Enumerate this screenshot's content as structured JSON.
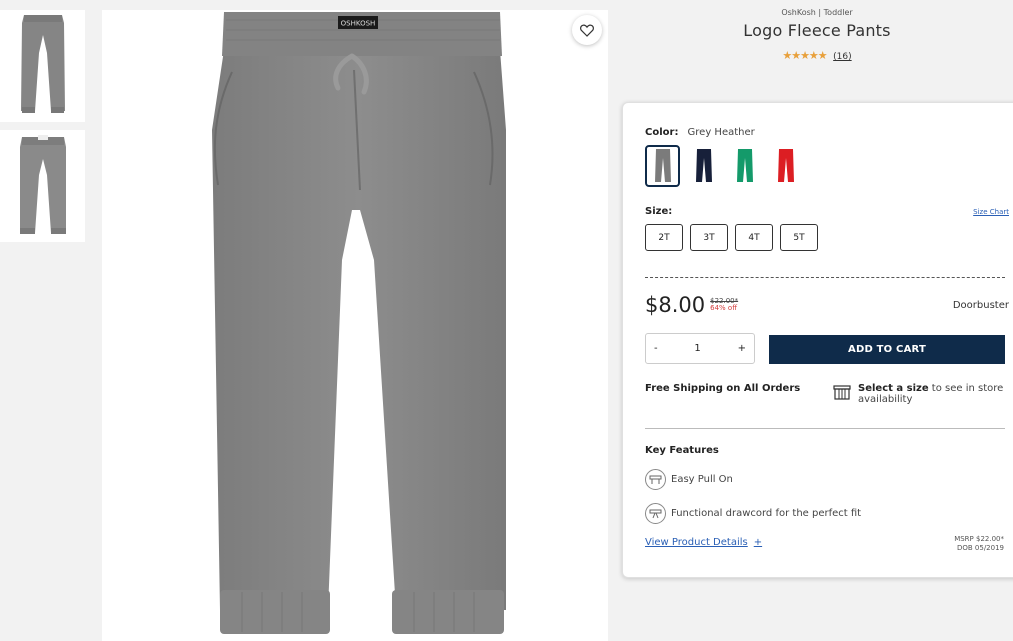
{
  "product": {
    "brand_line": "OshKosh | Toddler",
    "title": "Logo Fleece Pants",
    "stars": "★★★★★",
    "review_count": "(16)"
  },
  "thumbnails": [
    {
      "label": "front view"
    },
    {
      "label": "back view"
    }
  ],
  "main_image": {
    "waistband_logo": "OSHKOSH"
  },
  "color": {
    "label": "Color:",
    "value": "Grey Heather",
    "swatches": [
      {
        "name": "grey",
        "hex": "#7b7b7b",
        "selected": true
      },
      {
        "name": "navy",
        "hex": "#17203a",
        "selected": false
      },
      {
        "name": "green",
        "hex": "#149a6a",
        "selected": false
      },
      {
        "name": "red",
        "hex": "#dc1e23",
        "selected": false
      }
    ]
  },
  "size": {
    "label": "Size:",
    "chart_link": "Size Chart",
    "options": [
      "2T",
      "3T",
      "4T",
      "5T"
    ]
  },
  "price": {
    "current": "$8.00",
    "original": "$22.00*",
    "discount": "64% off",
    "badge": "Doorbuster"
  },
  "quantity": {
    "minus": "-",
    "value": "1",
    "plus": "+"
  },
  "add_to_cart": "ADD TO CART",
  "shipping": "Free Shipping on All Orders",
  "store": {
    "bold": "Select a size",
    "rest": " to see in store availability"
  },
  "key_features": {
    "title": "Key Features",
    "items": [
      "Easy Pull On",
      "Functional drawcord for the perfect fit"
    ]
  },
  "details_link": "View Product Details",
  "details_plus": "+",
  "msrp": {
    "line1": "MSRP $22.00*",
    "line2": "DOB 05/2019"
  },
  "colors": {
    "navy": "#0f2b4a",
    "link": "#2a5fb5",
    "star": "#e8a03b",
    "sale": "#d23c3c"
  }
}
